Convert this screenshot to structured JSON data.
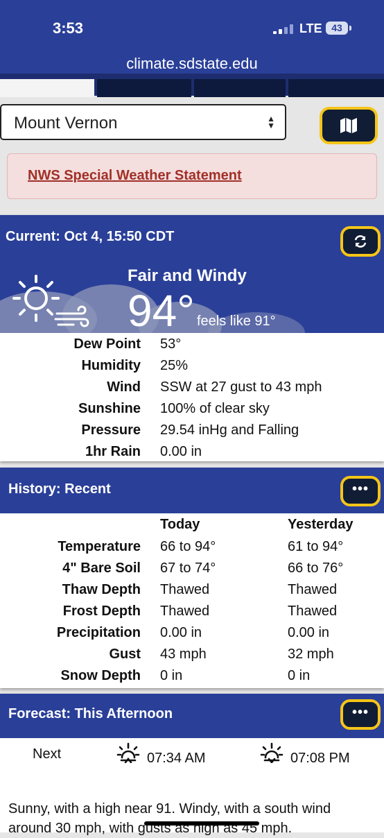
{
  "status": {
    "time": "3:53",
    "network": "LTE",
    "battery": "43"
  },
  "browser": {
    "url": "climate.sdstate.edu"
  },
  "location_select": {
    "value": "Mount Vernon"
  },
  "alert": {
    "text": "NWS Special Weather Statement"
  },
  "current": {
    "title": "Current: Oct 4, 15:50 CDT",
    "condition": "Fair and Windy",
    "temperature": "94°",
    "feels_like": "feels like 91°",
    "rows": [
      {
        "label": "Dew Point",
        "value": "53°"
      },
      {
        "label": "Humidity",
        "value": "25%"
      },
      {
        "label": "Wind",
        "value": "SSW at 27 gust to 43 mph"
      },
      {
        "label": "Sunshine",
        "value": "100% of clear sky"
      },
      {
        "label": "Pressure",
        "value": "29.54 inHg and Falling"
      },
      {
        "label": "1hr Rain",
        "value": "0.00 in"
      }
    ]
  },
  "history": {
    "title": "History: Recent",
    "col_today": "Today",
    "col_yesterday": "Yesterday",
    "rows": [
      {
        "label": "Temperature",
        "today": "66 to 94°",
        "yesterday": "61 to 94°"
      },
      {
        "label": "4\" Bare Soil",
        "today": "67 to 74°",
        "yesterday": "66 to 76°"
      },
      {
        "label": "Thaw Depth",
        "today": "Thawed",
        "yesterday": "Thawed"
      },
      {
        "label": "Frost Depth",
        "today": "Thawed",
        "yesterday": "Thawed"
      },
      {
        "label": "Precipitation",
        "today": "0.00 in",
        "yesterday": "0.00 in"
      },
      {
        "label": "Gust",
        "today": "43 mph",
        "yesterday": "32 mph"
      },
      {
        "label": "Snow Depth",
        "today": "0 in",
        "yesterday": "0 in"
      }
    ]
  },
  "forecast": {
    "title": "Forecast: This Afternoon",
    "next_label": "Next",
    "sunrise": "07:34 AM",
    "sunset": "07:08 PM",
    "text": "Sunny, with a high near 91. Windy, with a south wind around 30 mph, with gusts as high as 45 mph."
  },
  "icons": {
    "map": "map-icon",
    "refresh": "refresh-icon",
    "more": "more-icon",
    "sun": "sun-wind-icon",
    "sunrise": "sunrise-icon",
    "sunset": "sunset-icon"
  },
  "colors": {
    "header": "#2a3f98",
    "button": "#111d35",
    "button_border": "#f5c518",
    "alert_bg": "#f4dede",
    "alert_text": "#a03028"
  }
}
